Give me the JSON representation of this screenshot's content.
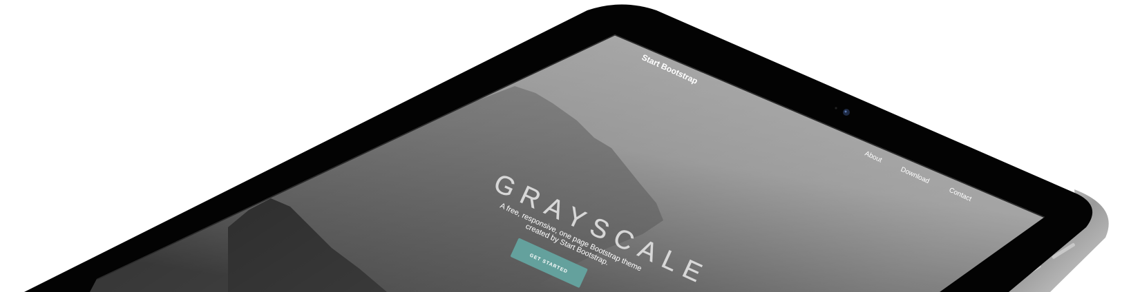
{
  "device": {
    "kind": "tablet",
    "frame_color": "#030303",
    "edge_color": "#b4b4b4",
    "camera_color": "#1e2a44"
  },
  "site": {
    "brand": "Start Bootstrap",
    "nav": [
      "About",
      "Download",
      "Contact"
    ],
    "hero": {
      "title": "GRAYSCALE",
      "subtitle_line1": "A free, responsive, one page Bootstrap theme",
      "subtitle_line2": "created by Start Bootstrap.",
      "cta_label": "GET STARTED"
    },
    "colors": {
      "accent": "#64a19d",
      "text": "#ffffff",
      "bg_dark": "#2c2c2c",
      "bg_light": "#b8b8b8"
    }
  }
}
